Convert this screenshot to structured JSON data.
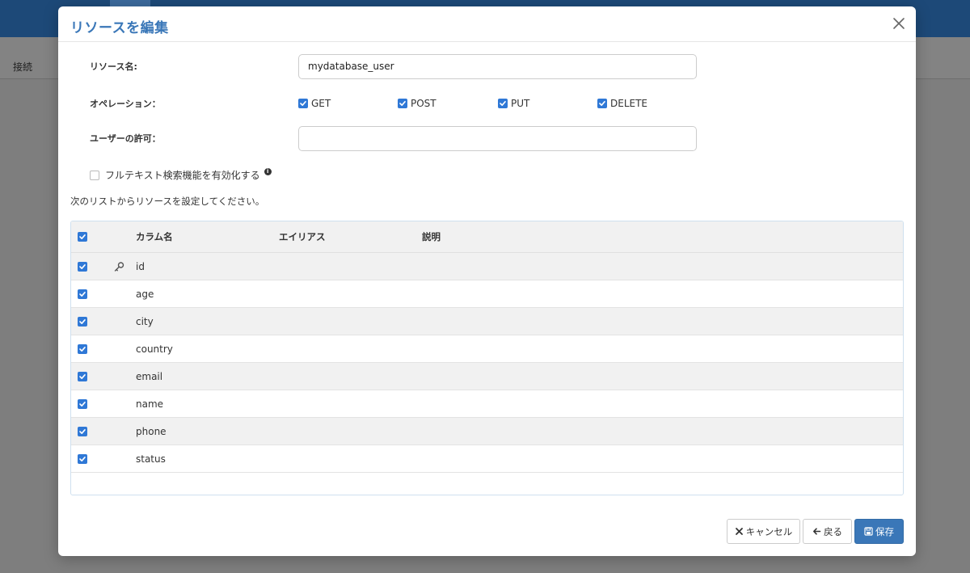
{
  "background": {
    "subbar_label": "接続"
  },
  "modal": {
    "title": "リソースを編集",
    "fields": {
      "resource_name_label": "リソース名:",
      "resource_name_value": "mydatabase_user",
      "operations_label": "オペレーション：",
      "user_permission_label": "ユーザーの許可：",
      "user_permission_value": ""
    },
    "operations": [
      {
        "label": "GET",
        "checked": true
      },
      {
        "label": "POST",
        "checked": true
      },
      {
        "label": "PUT",
        "checked": true
      },
      {
        "label": "DELETE",
        "checked": true
      }
    ],
    "full_text_search": {
      "label": "フルテキスト検索機能を有効化する",
      "checked": false
    },
    "instruction": "次のリストからリソースを設定してください。",
    "table": {
      "headers": {
        "column_name": "カラム名",
        "alias": "エイリアス",
        "description": "説明"
      },
      "rows": [
        {
          "name": "id",
          "checked": true,
          "is_key": true
        },
        {
          "name": "age",
          "checked": true,
          "is_key": false
        },
        {
          "name": "city",
          "checked": true,
          "is_key": false
        },
        {
          "name": "country",
          "checked": true,
          "is_key": false
        },
        {
          "name": "email",
          "checked": true,
          "is_key": false
        },
        {
          "name": "name",
          "checked": true,
          "is_key": false
        },
        {
          "name": "phone",
          "checked": true,
          "is_key": false
        },
        {
          "name": "status",
          "checked": true,
          "is_key": false
        }
      ]
    },
    "buttons": {
      "cancel": "キャンセル",
      "back": "戻る",
      "save": "保存"
    }
  },
  "colors": {
    "accent": "#3a77b8",
    "checkbox": "#2f78d6"
  }
}
